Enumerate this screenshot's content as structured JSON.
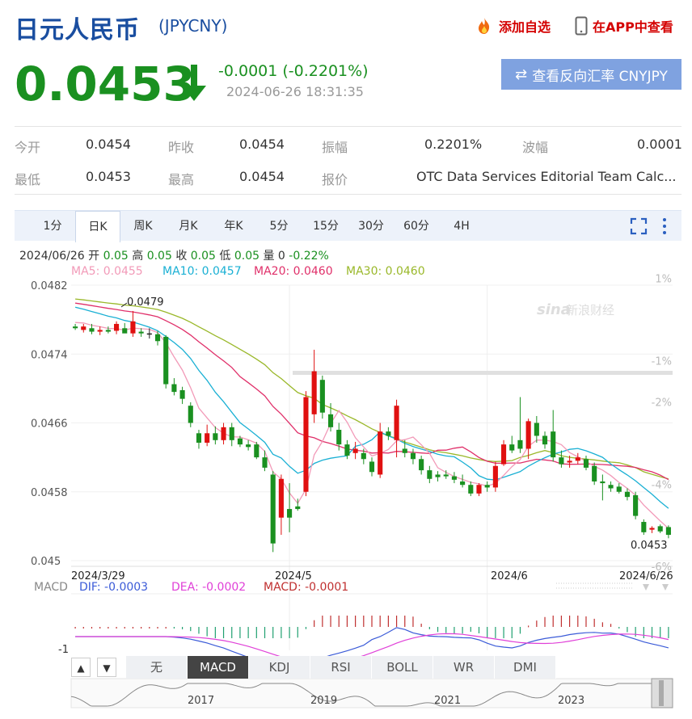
{
  "header": {
    "title": "日元人民币",
    "code": "(JPYCNY)",
    "add_watch": "添加自选",
    "app_view": "在APP中查看",
    "price": "0.0453",
    "change": "-0.0001 (-0.2201%)",
    "timestamp": "2024-06-26 18:31:35",
    "reverse_btn": "查看反向汇率 CNYJPY"
  },
  "stats": [
    {
      "label": "今开",
      "value": "0.0454"
    },
    {
      "label": "昨收",
      "value": "0.0454"
    },
    {
      "label": "振幅",
      "value": "0.2201%"
    },
    {
      "label": "波幅",
      "value": "0.0001"
    },
    {
      "label": "最低",
      "value": "0.0453"
    },
    {
      "label": "最高",
      "value": "0.0454"
    },
    {
      "label": "报价",
      "value": "OTC Data Services Editorial Team Calc..."
    }
  ],
  "tabs": [
    "1分",
    "日K",
    "周K",
    "月K",
    "年K",
    "5分",
    "15分",
    "30分",
    "60分",
    "4H"
  ],
  "active_tab": "日K",
  "ohlc_info": {
    "date": "2024/06/26",
    "open_label": "开",
    "open": "0.05",
    "high_label": "高",
    "high": "0.05",
    "close_label": "收",
    "close": "0.05",
    "low_label": "低",
    "low": "0.05",
    "vol_label": "量",
    "vol": "0",
    "pct": "-0.22%"
  },
  "ma": {
    "ma5": "MA5: 0.0455",
    "ma10": "MA10: 0.0457",
    "ma20": "MA20: 0.0460",
    "ma30": "MA30: 0.0460"
  },
  "macd_info": {
    "label": "MACD",
    "dif": "DIF: -0.0003",
    "dea": "DEA: -0.0002",
    "macd": "MACD: -0.0001"
  },
  "indicators": [
    "无",
    "MACD",
    "KDJ",
    "RSI",
    "BOLL",
    "WR",
    "DMI"
  ],
  "active_indicator": "MACD",
  "watermark": "新浪财经",
  "colors": {
    "up": "#e01010",
    "down": "#1a9020",
    "ma5": "#f29ab8",
    "ma10": "#1ab0d4",
    "ma20": "#e0306a",
    "ma30": "#9ab82a",
    "dif": "#3b5bd8",
    "dea": "#e040d8"
  },
  "chart_data": {
    "type": "candlestick",
    "ylim": [
      0.045,
      0.0482
    ],
    "yticks": [
      "0.0482",
      "0.0474",
      "0.0466",
      "0.0458",
      "0.045"
    ],
    "pct_ticks": [
      "1%",
      "-1%",
      "-2%",
      "-4%",
      "-6%"
    ],
    "x_labels": [
      "2024/3/29",
      "2024/5",
      "2024/6",
      "2024/6/26"
    ],
    "annotations": {
      "max": "0.0479",
      "min": "0.0453"
    },
    "candles": [
      {
        "o": 0.04772,
        "h": 0.04775,
        "l": 0.04768,
        "c": 0.0477
      },
      {
        "o": 0.04768,
        "h": 0.04775,
        "l": 0.04765,
        "c": 0.04772
      },
      {
        "o": 0.0477,
        "h": 0.04775,
        "l": 0.04763,
        "c": 0.04766
      },
      {
        "o": 0.04766,
        "h": 0.04772,
        "l": 0.04762,
        "c": 0.04768
      },
      {
        "o": 0.04768,
        "h": 0.04772,
        "l": 0.04764,
        "c": 0.04766
      },
      {
        "o": 0.04767,
        "h": 0.04778,
        "l": 0.04763,
        "c": 0.04775
      },
      {
        "o": 0.0477,
        "h": 0.04776,
        "l": 0.04765,
        "c": 0.04764
      },
      {
        "o": 0.04764,
        "h": 0.0479,
        "l": 0.0476,
        "c": 0.04778
      },
      {
        "o": 0.04766,
        "h": 0.0477,
        "l": 0.0476,
        "c": 0.04764
      },
      {
        "o": 0.04764,
        "h": 0.0477,
        "l": 0.04758,
        "c": 0.04763
      },
      {
        "o": 0.04763,
        "h": 0.04767,
        "l": 0.0475,
        "c": 0.04755
      },
      {
        "o": 0.0476,
        "h": 0.04762,
        "l": 0.047,
        "c": 0.04705
      },
      {
        "o": 0.04705,
        "h": 0.04712,
        "l": 0.04692,
        "c": 0.04696
      },
      {
        "o": 0.04698,
        "h": 0.04702,
        "l": 0.04682,
        "c": 0.04688
      },
      {
        "o": 0.0468,
        "h": 0.04684,
        "l": 0.04655,
        "c": 0.0466
      },
      {
        "o": 0.04648,
        "h": 0.04652,
        "l": 0.0463,
        "c": 0.04637
      },
      {
        "o": 0.04637,
        "h": 0.04658,
        "l": 0.04633,
        "c": 0.04648
      },
      {
        "o": 0.04648,
        "h": 0.04656,
        "l": 0.04635,
        "c": 0.0464
      },
      {
        "o": 0.0464,
        "h": 0.0466,
        "l": 0.04635,
        "c": 0.04655
      },
      {
        "o": 0.04655,
        "h": 0.0466,
        "l": 0.04633,
        "c": 0.0464
      },
      {
        "o": 0.04642,
        "h": 0.04645,
        "l": 0.04632,
        "c": 0.04635
      },
      {
        "o": 0.04635,
        "h": 0.0464,
        "l": 0.04628,
        "c": 0.04632
      },
      {
        "o": 0.04635,
        "h": 0.04638,
        "l": 0.04618,
        "c": 0.0462
      },
      {
        "o": 0.0462,
        "h": 0.04628,
        "l": 0.04604,
        "c": 0.04608
      },
      {
        "o": 0.046,
        "h": 0.04604,
        "l": 0.0451,
        "c": 0.0452
      },
      {
        "o": 0.0455,
        "h": 0.046,
        "l": 0.0453,
        "c": 0.04595
      },
      {
        "o": 0.0456,
        "h": 0.0459,
        "l": 0.04533,
        "c": 0.0455
      },
      {
        "o": 0.04563,
        "h": 0.04572,
        "l": 0.04558,
        "c": 0.0456
      },
      {
        "o": 0.0458,
        "h": 0.04697,
        "l": 0.04575,
        "c": 0.0469
      },
      {
        "o": 0.0467,
        "h": 0.04745,
        "l": 0.0466,
        "c": 0.0472
      },
      {
        "o": 0.0471,
        "h": 0.04715,
        "l": 0.04665,
        "c": 0.04672
      },
      {
        "o": 0.0467,
        "h": 0.04683,
        "l": 0.0465,
        "c": 0.04655
      },
      {
        "o": 0.04652,
        "h": 0.0466,
        "l": 0.04628,
        "c": 0.04635
      },
      {
        "o": 0.04635,
        "h": 0.0464,
        "l": 0.04618,
        "c": 0.04622
      },
      {
        "o": 0.04625,
        "h": 0.04638,
        "l": 0.04618,
        "c": 0.0463
      },
      {
        "o": 0.04625,
        "h": 0.0463,
        "l": 0.04612,
        "c": 0.04618
      },
      {
        "o": 0.04615,
        "h": 0.0462,
        "l": 0.04598,
        "c": 0.04603
      },
      {
        "o": 0.046,
        "h": 0.0466,
        "l": 0.04596,
        "c": 0.0465
      },
      {
        "o": 0.0465,
        "h": 0.04655,
        "l": 0.0464,
        "c": 0.04645
      },
      {
        "o": 0.0464,
        "h": 0.04687,
        "l": 0.0462,
        "c": 0.0468
      },
      {
        "o": 0.0463,
        "h": 0.0464,
        "l": 0.0462,
        "c": 0.04625
      },
      {
        "o": 0.04625,
        "h": 0.0463,
        "l": 0.04612,
        "c": 0.04618
      },
      {
        "o": 0.04618,
        "h": 0.04622,
        "l": 0.046,
        "c": 0.04605
      },
      {
        "o": 0.04605,
        "h": 0.0461,
        "l": 0.0459,
        "c": 0.04595
      },
      {
        "o": 0.046,
        "h": 0.04604,
        "l": 0.04592,
        "c": 0.04597
      },
      {
        "o": 0.046,
        "h": 0.04605,
        "l": 0.04595,
        "c": 0.04598
      },
      {
        "o": 0.04598,
        "h": 0.04603,
        "l": 0.0459,
        "c": 0.04594
      },
      {
        "o": 0.04592,
        "h": 0.046,
        "l": 0.04585,
        "c": 0.04588
      },
      {
        "o": 0.04588,
        "h": 0.04592,
        "l": 0.04575,
        "c": 0.04578
      },
      {
        "o": 0.04578,
        "h": 0.0459,
        "l": 0.04575,
        "c": 0.04588
      },
      {
        "o": 0.04588,
        "h": 0.04592,
        "l": 0.0458,
        "c": 0.04585
      },
      {
        "o": 0.04585,
        "h": 0.04615,
        "l": 0.0458,
        "c": 0.0461
      },
      {
        "o": 0.04612,
        "h": 0.0464,
        "l": 0.0461,
        "c": 0.04635
      },
      {
        "o": 0.04635,
        "h": 0.04645,
        "l": 0.04625,
        "c": 0.04628
      },
      {
        "o": 0.0464,
        "h": 0.0469,
        "l": 0.04625,
        "c": 0.0463
      },
      {
        "o": 0.0463,
        "h": 0.04665,
        "l": 0.04618,
        "c": 0.04662
      },
      {
        "o": 0.0466,
        "h": 0.04668,
        "l": 0.04637,
        "c": 0.04645
      },
      {
        "o": 0.04645,
        "h": 0.0465,
        "l": 0.0463,
        "c": 0.04635
      },
      {
        "o": 0.0465,
        "h": 0.04675,
        "l": 0.04615,
        "c": 0.0462
      },
      {
        "o": 0.0462,
        "h": 0.04628,
        "l": 0.04608,
        "c": 0.04612
      },
      {
        "o": 0.04614,
        "h": 0.04622,
        "l": 0.04608,
        "c": 0.04616
      },
      {
        "o": 0.04616,
        "h": 0.04625,
        "l": 0.04612,
        "c": 0.0462
      },
      {
        "o": 0.04618,
        "h": 0.04622,
        "l": 0.04605,
        "c": 0.04608
      },
      {
        "o": 0.0461,
        "h": 0.04614,
        "l": 0.04588,
        "c": 0.04592
      },
      {
        "o": 0.04592,
        "h": 0.046,
        "l": 0.0457,
        "c": 0.0459
      },
      {
        "o": 0.04588,
        "h": 0.04592,
        "l": 0.0458,
        "c": 0.04584
      },
      {
        "o": 0.04586,
        "h": 0.0459,
        "l": 0.04578,
        "c": 0.0458
      },
      {
        "o": 0.0458,
        "h": 0.04584,
        "l": 0.0457,
        "c": 0.04574
      },
      {
        "o": 0.04576,
        "h": 0.0458,
        "l": 0.04548,
        "c": 0.04552
      },
      {
        "o": 0.04545,
        "h": 0.04548,
        "l": 0.0453,
        "c": 0.04533
      },
      {
        "o": 0.04536,
        "h": 0.0454,
        "l": 0.04532,
        "c": 0.04538
      },
      {
        "o": 0.0454,
        "h": 0.04542,
        "l": 0.04532,
        "c": 0.04534
      },
      {
        "o": 0.04539,
        "h": 0.04541,
        "l": 0.04526,
        "c": 0.0453
      }
    ]
  }
}
